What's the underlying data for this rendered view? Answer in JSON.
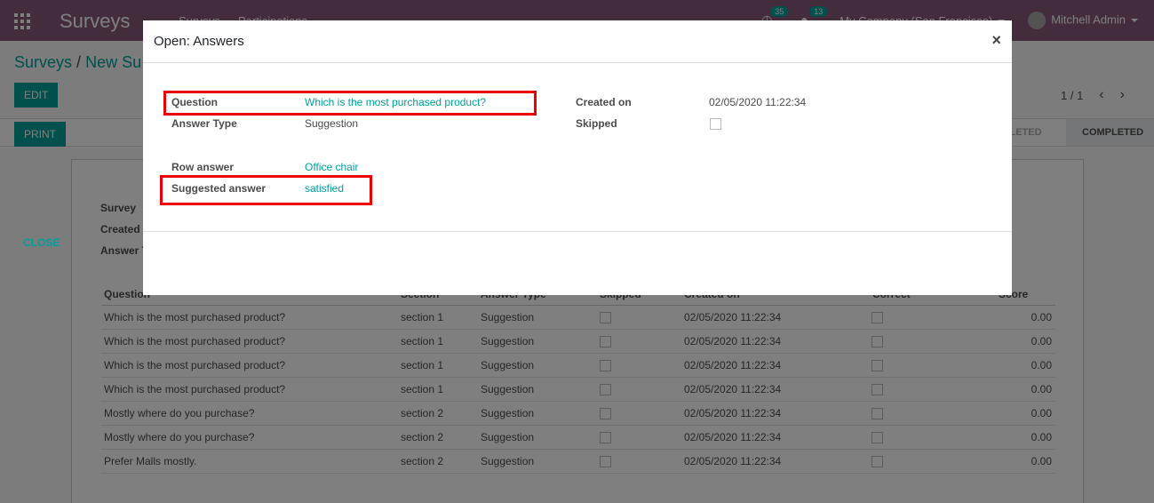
{
  "navbar": {
    "app_title": "Surveys",
    "menu": [
      "Surveys",
      "Participations"
    ],
    "activity_count": "35",
    "messages_count": "13",
    "company": "My Company (San Francisco)",
    "user": "Mitchell Admin"
  },
  "control_panel": {
    "breadcrumb_root": "Surveys",
    "breadcrumb_sep": "/",
    "breadcrumb_current": "New Su",
    "edit_label": "EDIT",
    "print_label": "PRINT",
    "pager": "1 / 1",
    "status_prev": "MPLETED",
    "status_current": "COMPLETED"
  },
  "sheet": {
    "labels": [
      "Survey",
      "Created",
      "Answer T"
    ],
    "columns": [
      "Question",
      "Section",
      "Answer Type",
      "Skipped",
      "Created on",
      "Correct",
      "Score"
    ],
    "rows": [
      {
        "question": "Which is the most purchased product?",
        "section": "section 1",
        "type": "Suggestion",
        "created": "02/05/2020 11:22:34",
        "score": "0.00"
      },
      {
        "question": "Which is the most purchased product?",
        "section": "section 1",
        "type": "Suggestion",
        "created": "02/05/2020 11:22:34",
        "score": "0.00"
      },
      {
        "question": "Which is the most purchased product?",
        "section": "section 1",
        "type": "Suggestion",
        "created": "02/05/2020 11:22:34",
        "score": "0.00"
      },
      {
        "question": "Which is the most purchased product?",
        "section": "section 1",
        "type": "Suggestion",
        "created": "02/05/2020 11:22:34",
        "score": "0.00"
      },
      {
        "question": "Mostly where do you purchase?",
        "section": "section 2",
        "type": "Suggestion",
        "created": "02/05/2020 11:22:34",
        "score": "0.00"
      },
      {
        "question": "Mostly where do you purchase?",
        "section": "section 2",
        "type": "Suggestion",
        "created": "02/05/2020 11:22:34",
        "score": "0.00"
      },
      {
        "question": "Prefer Malls mostly.",
        "section": "section 2",
        "type": "Suggestion",
        "created": "02/05/2020 11:22:34",
        "score": "0.00"
      }
    ]
  },
  "modal": {
    "title": "Open: Answers",
    "close_icon": "×",
    "question_label": "Question",
    "question_value": "Which is the most purchased product?",
    "answer_type_label": "Answer Type",
    "answer_type_value": "Suggestion",
    "row_answer_label": "Row answer",
    "row_answer_value": "Office chair",
    "suggested_label": "Suggested answer",
    "suggested_value": "satisfied",
    "created_on_label": "Created on",
    "created_on_value": "02/05/2020 11:22:34",
    "skipped_label": "Skipped",
    "close_button": "CLOSE"
  },
  "colors": {
    "brand": "#875a7b",
    "accent": "#00a09d",
    "highlight": "#e00000"
  }
}
